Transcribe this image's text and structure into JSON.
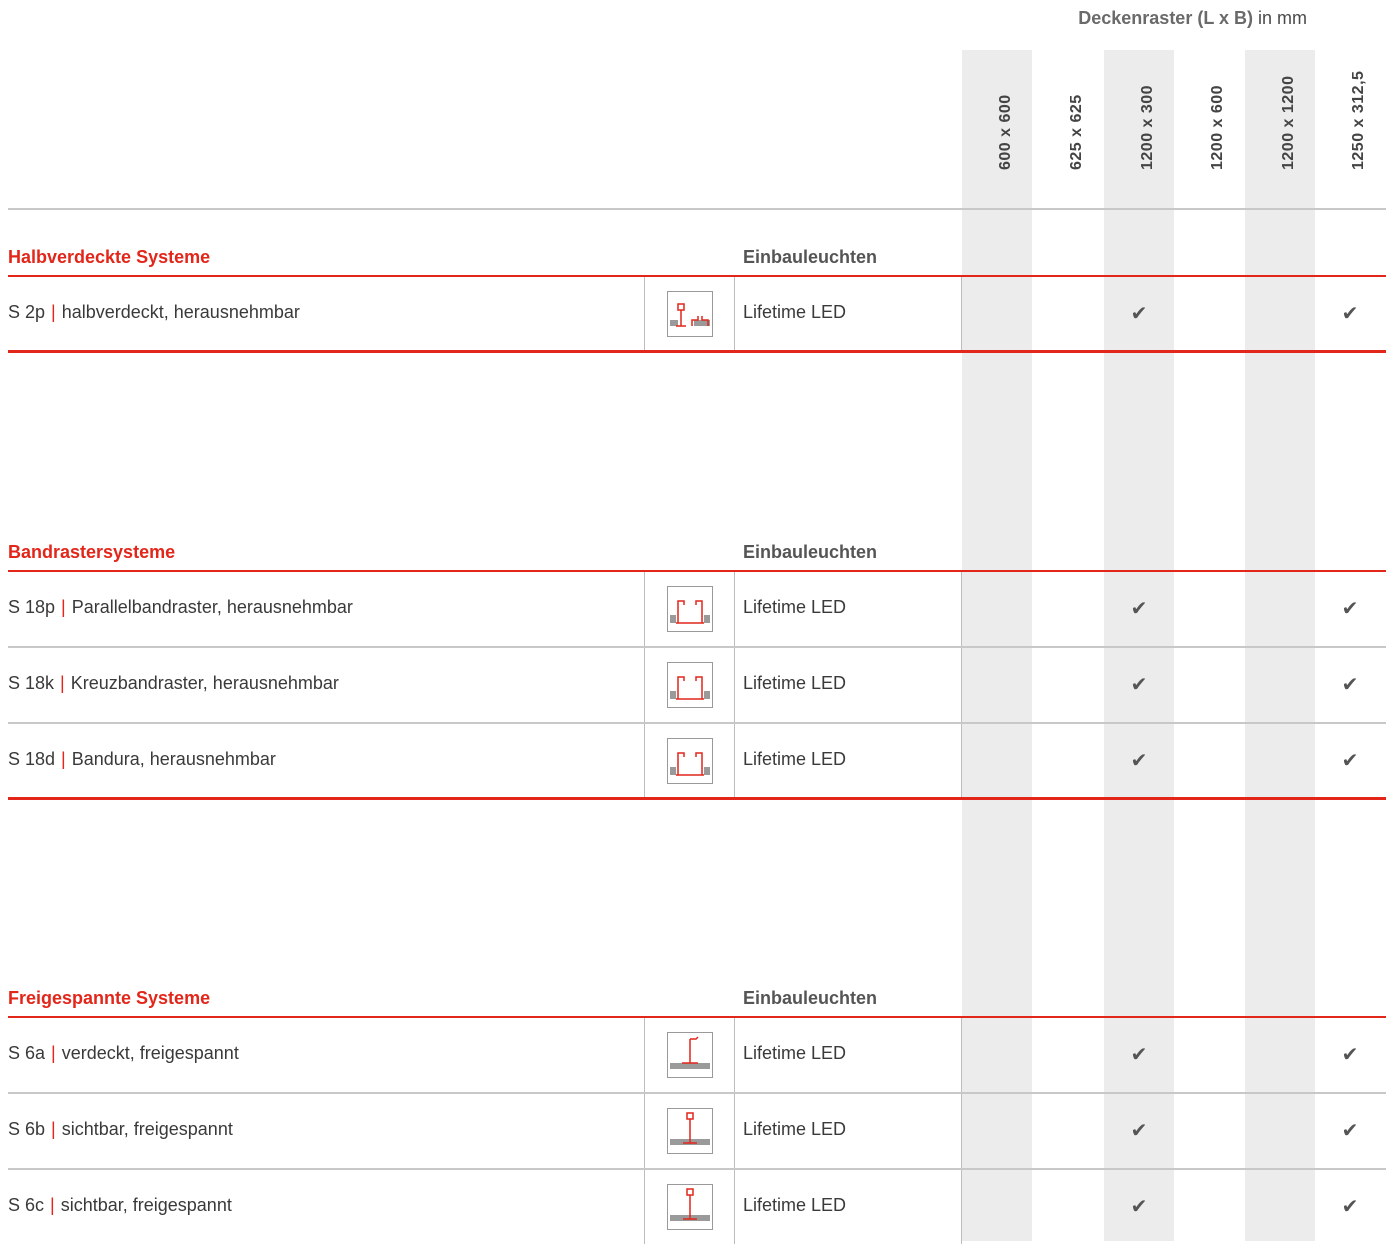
{
  "header": {
    "title_bold": "Deckenraster (L x B)",
    "title_rest": " in mm",
    "columns": [
      "600 x 600",
      "625 x 625",
      "1200 x 300",
      "1200 x 600",
      "1200 x 1200",
      "1250 x 312,5"
    ]
  },
  "sections": [
    {
      "title": "Halbverdeckte Systeme",
      "subtitle": "Einbauleuchten",
      "rows": [
        {
          "code": "S 2p",
          "desc": "halbverdeckt, herausnehmbar",
          "icon": "ceiling-profile-icon",
          "lamp": "Lifetime LED",
          "checks": [
            "",
            "",
            "✔",
            "",
            "",
            "✔"
          ]
        }
      ]
    },
    {
      "title": "Bandrastersysteme",
      "subtitle": "Einbauleuchten",
      "rows": [
        {
          "code": "S 18p",
          "desc": "Parallelbandraster, herausnehmbar",
          "icon": "ceiling-profile-icon",
          "lamp": "Lifetime LED",
          "checks": [
            "",
            "",
            "✔",
            "",
            "",
            "✔"
          ]
        },
        {
          "code": "S 18k",
          "desc": "Kreuzbandraster, herausnehmbar",
          "icon": "ceiling-profile-icon",
          "lamp": "Lifetime LED",
          "checks": [
            "",
            "",
            "✔",
            "",
            "",
            "✔"
          ]
        },
        {
          "code": "S 18d",
          "desc": "Bandura, herausnehmbar",
          "icon": "ceiling-profile-icon",
          "lamp": "Lifetime LED",
          "checks": [
            "",
            "",
            "✔",
            "",
            "",
            "✔"
          ]
        }
      ]
    },
    {
      "title": "Freigespannte Systeme",
      "subtitle": "Einbauleuchten",
      "rows": [
        {
          "code": "S 6a",
          "desc": "verdeckt, freigespannt",
          "icon": "ceiling-profile-icon",
          "lamp": "Lifetime LED",
          "checks": [
            "",
            "",
            "✔",
            "",
            "",
            "✔"
          ]
        },
        {
          "code": "S 6b",
          "desc": "sichtbar, freigespannt",
          "icon": "ceiling-profile-icon",
          "lamp": "Lifetime LED",
          "checks": [
            "",
            "",
            "✔",
            "",
            "",
            "✔"
          ]
        },
        {
          "code": "S 6c",
          "desc": "sichtbar, freigespannt",
          "icon": "ceiling-profile-icon",
          "lamp": "Lifetime LED",
          "checks": [
            "",
            "",
            "✔",
            "",
            "",
            "✔"
          ]
        }
      ]
    }
  ],
  "colors": {
    "accent": "#e2261a",
    "shade": "#ececec",
    "grid": "#c8c8c8"
  }
}
